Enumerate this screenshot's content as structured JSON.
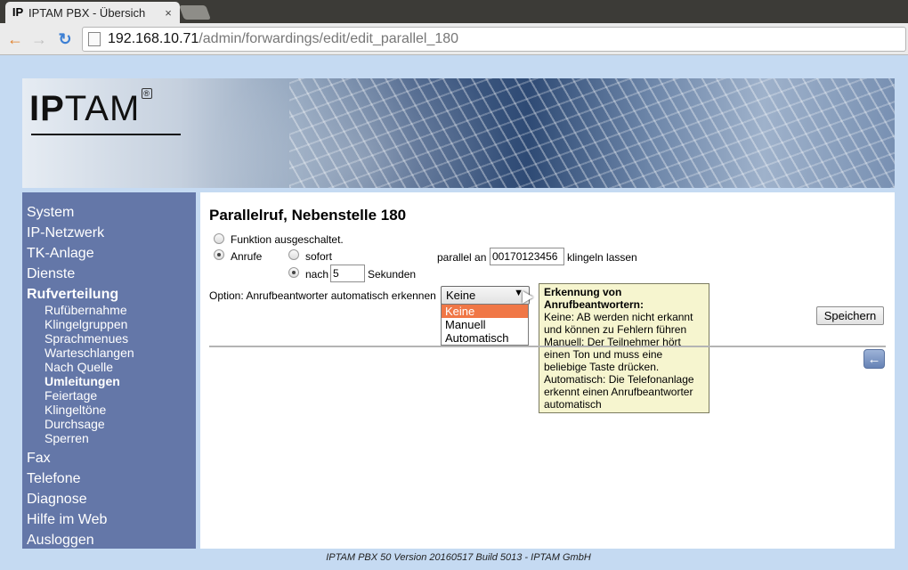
{
  "browser": {
    "tab_favicon": "IP",
    "tab_title": "IPTAM PBX - Übersich",
    "tab_close": "×",
    "url_host": "192.168.10.71",
    "url_path": "/admin/forwardings/edit/edit_parallel_180"
  },
  "banner": {
    "logo_bold": "IP",
    "logo_rest": "TAM",
    "logo_mark": "®"
  },
  "sidebar": {
    "items_top": [
      "System",
      "IP-Netzwerk",
      "TK-Anlage",
      "Dienste"
    ],
    "active_main": "Rufverteilung",
    "sub_items": [
      "Rufübernahme",
      "Klingelgruppen",
      "Sprachmenues",
      "Warteschlangen",
      "Nach Quelle",
      "Umleitungen",
      "Feiertage",
      "Klingeltöne",
      "Durchsage",
      "Sperren"
    ],
    "active_sub": "Umleitungen",
    "items_bottom": [
      "Fax",
      "Telefone",
      "Diagnose",
      "Hilfe im Web",
      "Ausloggen"
    ]
  },
  "form": {
    "title": "Parallelruf, Nebenstelle 180",
    "radio_off_label": "Funktion ausgeschaltet.",
    "radio_calls_label": "Anrufe",
    "radio_immediate_label": "sofort",
    "radio_after_label": "nach",
    "delay_value": "5",
    "delay_unit": "Sekunden",
    "parallel_label": "parallel an",
    "parallel_number": "00170123456",
    "ring_label": "klingeln lassen",
    "option_label": "Option: Anrufbeantworter automatisch erkennen",
    "select_value": "Keine",
    "select_options": [
      "Keine",
      "Manuell",
      "Automatisch"
    ],
    "save_label": "Speichern"
  },
  "tooltip": {
    "title": "Erkennung von Anrufbeantwortern:",
    "body": "Keine: AB werden nicht erkannt und können zu Fehlern führen Manuell: Der Teilnehmer hört einen Ton und muss eine beliebige Taste drücken. Automatisch: Die Telefonanlage erkennt einen Anrufbeantworter automatisch"
  },
  "footer": "IPTAM PBX 50 Version 20160517 Build 5013 - IPTAM GmbH",
  "icons": [
    "back-arrow-icon",
    "forward-arrow-icon",
    "reload-icon",
    "page-icon",
    "return-icon",
    "cursor-icon"
  ],
  "colors": {
    "sidebar_bg": "#6477a8",
    "page_bg": "#c5daf2",
    "option_highlight": "#f07746",
    "tooltip_bg": "#f6f5cf"
  }
}
